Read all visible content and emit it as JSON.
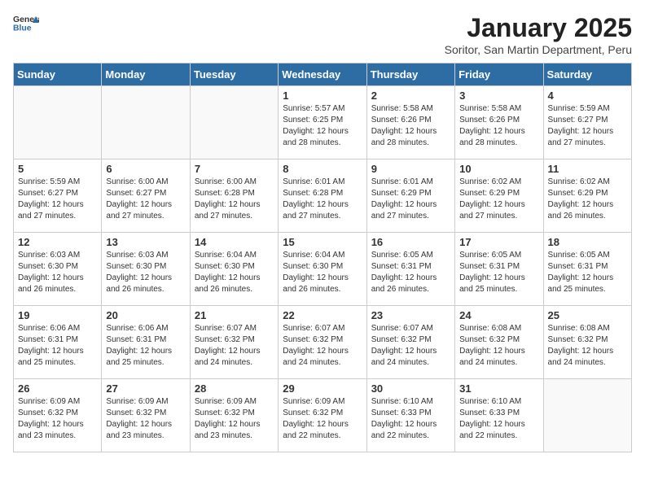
{
  "header": {
    "logo_general": "General",
    "logo_blue": "Blue",
    "title": "January 2025",
    "subtitle": "Soritor, San Martin Department, Peru"
  },
  "days_of_week": [
    "Sunday",
    "Monday",
    "Tuesday",
    "Wednesday",
    "Thursday",
    "Friday",
    "Saturday"
  ],
  "weeks": [
    [
      {
        "day": "",
        "info": ""
      },
      {
        "day": "",
        "info": ""
      },
      {
        "day": "",
        "info": ""
      },
      {
        "day": "1",
        "info": "Sunrise: 5:57 AM\nSunset: 6:25 PM\nDaylight: 12 hours\nand 28 minutes."
      },
      {
        "day": "2",
        "info": "Sunrise: 5:58 AM\nSunset: 6:26 PM\nDaylight: 12 hours\nand 28 minutes."
      },
      {
        "day": "3",
        "info": "Sunrise: 5:58 AM\nSunset: 6:26 PM\nDaylight: 12 hours\nand 28 minutes."
      },
      {
        "day": "4",
        "info": "Sunrise: 5:59 AM\nSunset: 6:27 PM\nDaylight: 12 hours\nand 27 minutes."
      }
    ],
    [
      {
        "day": "5",
        "info": "Sunrise: 5:59 AM\nSunset: 6:27 PM\nDaylight: 12 hours\nand 27 minutes."
      },
      {
        "day": "6",
        "info": "Sunrise: 6:00 AM\nSunset: 6:27 PM\nDaylight: 12 hours\nand 27 minutes."
      },
      {
        "day": "7",
        "info": "Sunrise: 6:00 AM\nSunset: 6:28 PM\nDaylight: 12 hours\nand 27 minutes."
      },
      {
        "day": "8",
        "info": "Sunrise: 6:01 AM\nSunset: 6:28 PM\nDaylight: 12 hours\nand 27 minutes."
      },
      {
        "day": "9",
        "info": "Sunrise: 6:01 AM\nSunset: 6:29 PM\nDaylight: 12 hours\nand 27 minutes."
      },
      {
        "day": "10",
        "info": "Sunrise: 6:02 AM\nSunset: 6:29 PM\nDaylight: 12 hours\nand 27 minutes."
      },
      {
        "day": "11",
        "info": "Sunrise: 6:02 AM\nSunset: 6:29 PM\nDaylight: 12 hours\nand 26 minutes."
      }
    ],
    [
      {
        "day": "12",
        "info": "Sunrise: 6:03 AM\nSunset: 6:30 PM\nDaylight: 12 hours\nand 26 minutes."
      },
      {
        "day": "13",
        "info": "Sunrise: 6:03 AM\nSunset: 6:30 PM\nDaylight: 12 hours\nand 26 minutes."
      },
      {
        "day": "14",
        "info": "Sunrise: 6:04 AM\nSunset: 6:30 PM\nDaylight: 12 hours\nand 26 minutes."
      },
      {
        "day": "15",
        "info": "Sunrise: 6:04 AM\nSunset: 6:30 PM\nDaylight: 12 hours\nand 26 minutes."
      },
      {
        "day": "16",
        "info": "Sunrise: 6:05 AM\nSunset: 6:31 PM\nDaylight: 12 hours\nand 26 minutes."
      },
      {
        "day": "17",
        "info": "Sunrise: 6:05 AM\nSunset: 6:31 PM\nDaylight: 12 hours\nand 25 minutes."
      },
      {
        "day": "18",
        "info": "Sunrise: 6:05 AM\nSunset: 6:31 PM\nDaylight: 12 hours\nand 25 minutes."
      }
    ],
    [
      {
        "day": "19",
        "info": "Sunrise: 6:06 AM\nSunset: 6:31 PM\nDaylight: 12 hours\nand 25 minutes."
      },
      {
        "day": "20",
        "info": "Sunrise: 6:06 AM\nSunset: 6:31 PM\nDaylight: 12 hours\nand 25 minutes."
      },
      {
        "day": "21",
        "info": "Sunrise: 6:07 AM\nSunset: 6:32 PM\nDaylight: 12 hours\nand 24 minutes."
      },
      {
        "day": "22",
        "info": "Sunrise: 6:07 AM\nSunset: 6:32 PM\nDaylight: 12 hours\nand 24 minutes."
      },
      {
        "day": "23",
        "info": "Sunrise: 6:07 AM\nSunset: 6:32 PM\nDaylight: 12 hours\nand 24 minutes."
      },
      {
        "day": "24",
        "info": "Sunrise: 6:08 AM\nSunset: 6:32 PM\nDaylight: 12 hours\nand 24 minutes."
      },
      {
        "day": "25",
        "info": "Sunrise: 6:08 AM\nSunset: 6:32 PM\nDaylight: 12 hours\nand 24 minutes."
      }
    ],
    [
      {
        "day": "26",
        "info": "Sunrise: 6:09 AM\nSunset: 6:32 PM\nDaylight: 12 hours\nand 23 minutes."
      },
      {
        "day": "27",
        "info": "Sunrise: 6:09 AM\nSunset: 6:32 PM\nDaylight: 12 hours\nand 23 minutes."
      },
      {
        "day": "28",
        "info": "Sunrise: 6:09 AM\nSunset: 6:32 PM\nDaylight: 12 hours\nand 23 minutes."
      },
      {
        "day": "29",
        "info": "Sunrise: 6:09 AM\nSunset: 6:32 PM\nDaylight: 12 hours\nand 22 minutes."
      },
      {
        "day": "30",
        "info": "Sunrise: 6:10 AM\nSunset: 6:33 PM\nDaylight: 12 hours\nand 22 minutes."
      },
      {
        "day": "31",
        "info": "Sunrise: 6:10 AM\nSunset: 6:33 PM\nDaylight: 12 hours\nand 22 minutes."
      },
      {
        "day": "",
        "info": ""
      }
    ]
  ]
}
